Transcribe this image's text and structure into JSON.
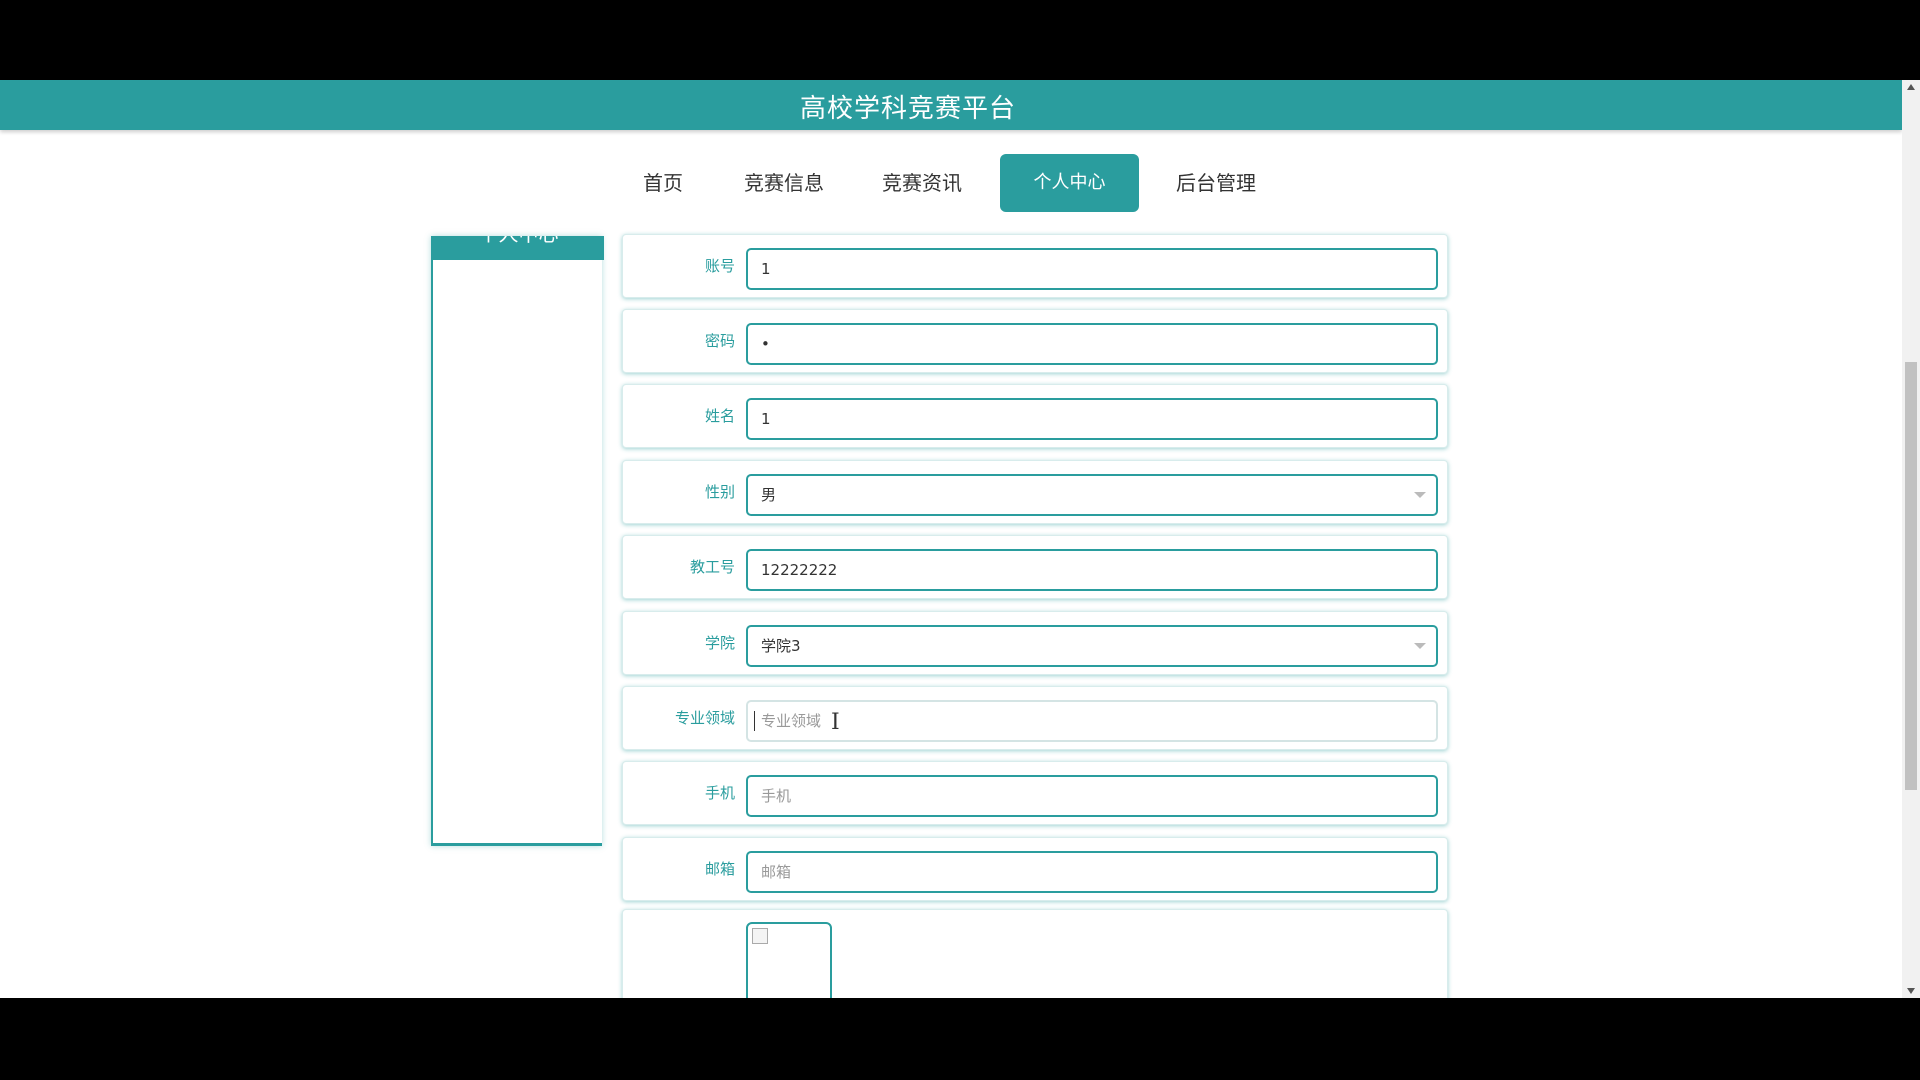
{
  "header": {
    "title": "高校学科竞赛平台"
  },
  "nav": {
    "items": [
      {
        "label": "首页"
      },
      {
        "label": "竞赛信息"
      },
      {
        "label": "竞赛资讯"
      },
      {
        "label": "个人中心",
        "active": true
      },
      {
        "label": "后台管理"
      }
    ]
  },
  "sidebar": {
    "title": "个人中心"
  },
  "form": {
    "account": {
      "label": "账号",
      "value": "1"
    },
    "password": {
      "label": "密码",
      "value": "•"
    },
    "name": {
      "label": "姓名",
      "value": "1"
    },
    "gender": {
      "label": "性别",
      "value": "男"
    },
    "staff_id": {
      "label": "教工号",
      "value": "12222222"
    },
    "college": {
      "label": "学院",
      "value": "学院3"
    },
    "specialty": {
      "label": "专业领域",
      "placeholder": "专业领域"
    },
    "phone": {
      "label": "手机",
      "placeholder": "手机"
    },
    "email": {
      "label": "邮箱",
      "placeholder": "邮箱"
    }
  },
  "colors": {
    "accent": "#2a9d9e"
  },
  "icons": {
    "select_arrow": "chevron-down-icon",
    "broken_image": "broken-image-icon"
  }
}
